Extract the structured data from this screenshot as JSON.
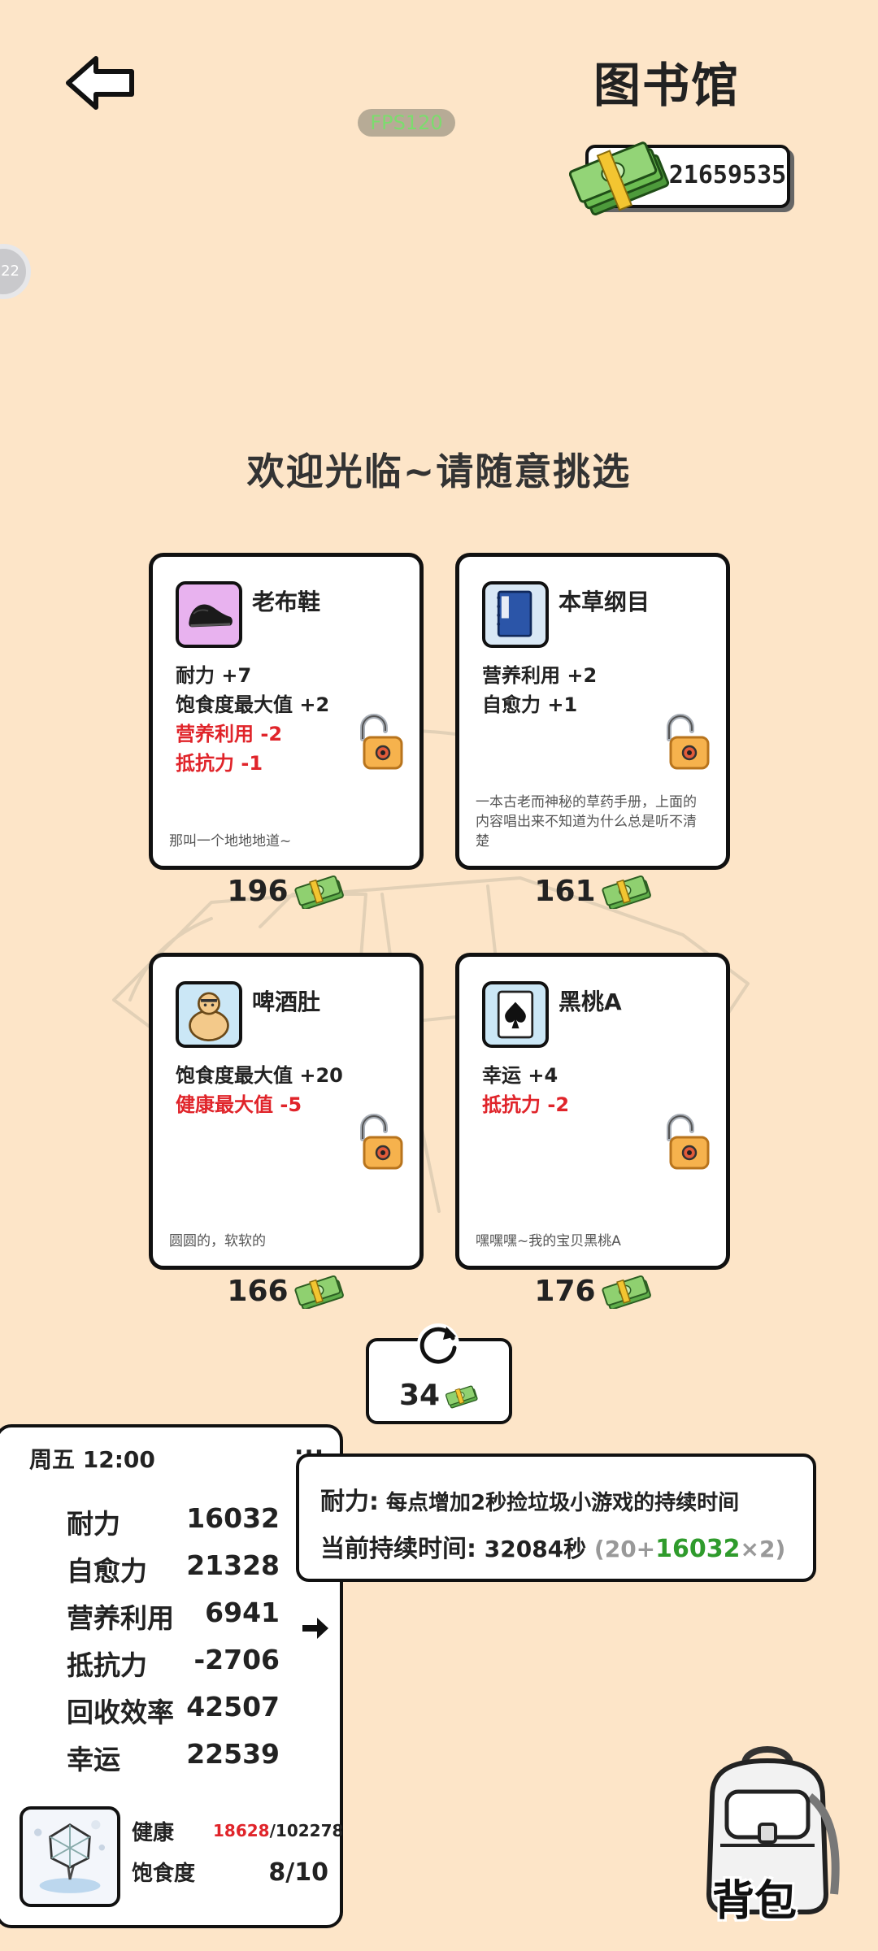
{
  "header": {
    "title": "图书馆",
    "fps": "FPS120",
    "money": "21659535",
    "side_bubble": "22"
  },
  "welcome": "欢迎光临~请随意挑选",
  "items": [
    {
      "name": "老布鞋",
      "icon": "shoe-icon",
      "stats": [
        {
          "text": "耐力 +7",
          "negative": false
        },
        {
          "text": "饱食度最大值 +2",
          "negative": false
        },
        {
          "text": "营养利用 -2",
          "negative": true
        },
        {
          "text": "抵抗力 -1",
          "negative": true
        }
      ],
      "desc": "那叫一个地地地道~",
      "price": "196"
    },
    {
      "name": "本草纲目",
      "icon": "book-icon",
      "stats": [
        {
          "text": "营养利用 +2",
          "negative": false
        },
        {
          "text": "自愈力 +1",
          "negative": false
        }
      ],
      "desc": "一本古老而神秘的草药手册，上面的内容唱出来不知道为什么总是听不清楚",
      "price": "161"
    },
    {
      "name": "啤酒肚",
      "icon": "beer-belly-icon",
      "stats": [
        {
          "text": "饱食度最大值 +20",
          "negative": false
        },
        {
          "text": "健康最大值 -5",
          "negative": true
        }
      ],
      "desc": "圆圆的，软软的",
      "price": "166"
    },
    {
      "name": "黑桃A",
      "icon": "ace-of-spades-icon",
      "stats": [
        {
          "text": "幸运 +4",
          "negative": false
        },
        {
          "text": "抵抗力 -2",
          "negative": true
        }
      ],
      "desc": "嘿嘿嘿~我的宝贝黑桃A",
      "price": "176"
    }
  ],
  "refresh": {
    "cost": "34"
  },
  "player": {
    "day": "周五 12:00",
    "menu": "...",
    "stats": [
      {
        "label": "耐力",
        "value": "16032"
      },
      {
        "label": "自愈力",
        "value": "21328"
      },
      {
        "label": "营养利用",
        "value": "6941"
      },
      {
        "label": "抵抗力",
        "value": "-2706"
      },
      {
        "label": "回收效率",
        "value": "42507"
      },
      {
        "label": "幸运",
        "value": "22539"
      }
    ],
    "health_label": "健康",
    "health_current": "18628",
    "health_max": "/102278",
    "fullness_label": "饱食度",
    "fullness": "8/10"
  },
  "tooltip": {
    "label": "耐力:",
    "desc": " 每点增加2秒捡垃圾小游戏的持续时间",
    "duration_label": "当前持续时间:",
    "duration_value": " 32084秒 ",
    "formula_open": "(20+",
    "formula_green": "16032",
    "formula_close": "×2)"
  },
  "backpack": {
    "label": "背包"
  },
  "colors": {
    "background": "#fde5c8",
    "negative": "#e0242a",
    "positive_green": "#2f9b2c",
    "fps_text": "#7cdc6e"
  }
}
